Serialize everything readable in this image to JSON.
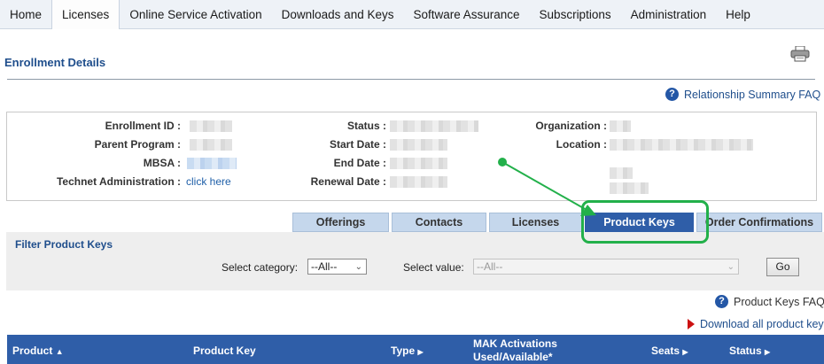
{
  "nav": {
    "items": [
      "Home",
      "Licenses",
      "Online Service Activation",
      "Downloads and Keys",
      "Software Assurance",
      "Subscriptions",
      "Administration",
      "Help"
    ],
    "active": "Licenses"
  },
  "page": {
    "title": "Enrollment Details",
    "printer_icon": "printer-icon"
  },
  "faq": {
    "relationship": "Relationship Summary FAQ",
    "product_keys": "Product Keys FAQ",
    "icon": "question-icon"
  },
  "details": {
    "enrollment_id_label": "Enrollment ID :",
    "parent_program_label": "Parent Program :",
    "mbsa_label": "MBSA :",
    "technet_label": "Technet Administration :",
    "technet_link": "click here",
    "status_label": "Status :",
    "start_date_label": "Start Date :",
    "end_date_label": "End Date :",
    "renewal_date_label": "Renewal Date :",
    "organization_label": "Organization :",
    "location_label": "Location :"
  },
  "tabs": [
    "Offerings",
    "Contacts",
    "Licenses",
    "Product Keys",
    "Order Confirmations"
  ],
  "active_tab": "Product Keys",
  "filter": {
    "title": "Filter Product Keys",
    "category_label": "Select category:",
    "category_value": "--All--",
    "value_label": "Select value:",
    "value_value": "--All--",
    "go": "Go"
  },
  "download_link": "Download all product keys",
  "table": {
    "columns": {
      "product": "Product",
      "product_key": "Product Key",
      "type": "Type",
      "mak_line1": "MAK Activations",
      "mak_line2": "Used/Available*",
      "seats": "Seats",
      "status": "Status"
    }
  },
  "colors": {
    "accent": "#2f5ea8",
    "highlight": "#22b04a",
    "nav_bg": "#eef2f7",
    "title": "#1f4e8c"
  }
}
